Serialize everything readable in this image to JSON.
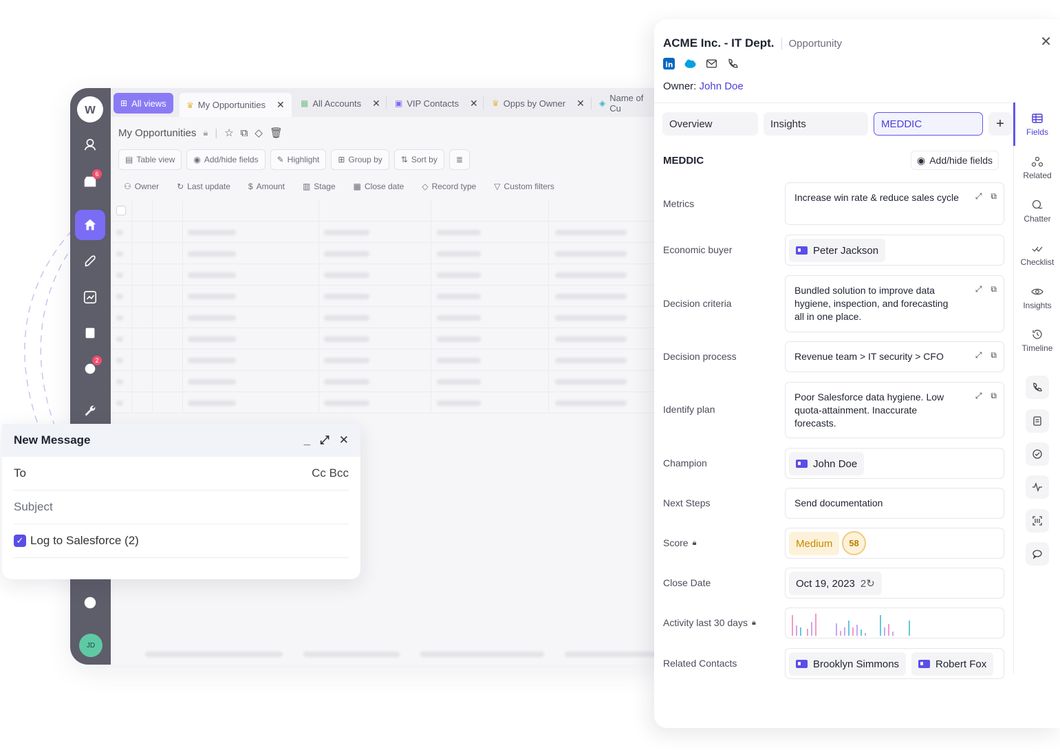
{
  "app": {
    "rail_badges": {
      "inbox": "6",
      "tasks": "2"
    },
    "avatar_initials": "JD",
    "tabs": [
      {
        "label": "All views",
        "icon": "grid-icon"
      },
      {
        "label": "My Opportunities",
        "icon": "crown-icon"
      },
      {
        "label": "All Accounts",
        "icon": "building-icon"
      },
      {
        "label": "VIP Contacts",
        "icon": "id-card-icon"
      },
      {
        "label": "Opps by Owner",
        "icon": "crown-icon"
      },
      {
        "label": "Name of Cu",
        "icon": "cube-icon"
      }
    ],
    "view_title": "My Opportunities",
    "toolbar": [
      "Table view",
      "Add/hide fields",
      "Highlight",
      "Group by",
      "Sort by"
    ],
    "filters": [
      "Owner",
      "Last update",
      "Amount",
      "Stage",
      "Close date",
      "Record type",
      "Custom filters"
    ]
  },
  "message": {
    "title": "New Message",
    "to_label": "To",
    "cc_bcc": "Cc Bcc",
    "subject_placeholder": "Subject",
    "log_label": "Log to Salesforce (2)"
  },
  "panel": {
    "title": "ACME Inc. - IT Dept.",
    "object_type": "Opportunity",
    "owner_label": "Owner:",
    "owner_name": "John Doe",
    "tabs": [
      "Overview",
      "Insights",
      "MEDDIC"
    ],
    "active_tab": "MEDDIC",
    "section_title": "MEDDIC",
    "add_hide_fields": "Add/hide fields",
    "fields": {
      "metrics": {
        "label": "Metrics",
        "value": "Increase win rate & reduce sales cycle"
      },
      "economic_buyer": {
        "label": "Economic buyer",
        "value": "Peter Jackson"
      },
      "decision_criteria": {
        "label": "Decision criteria",
        "value": "Bundled solution to improve data hygiene, inspection, and forecasting all in one place."
      },
      "decision_process": {
        "label": "Decision process",
        "value": "Revenue team > IT security > CFO"
      },
      "identify_plan": {
        "label": "Identify plan",
        "value": "Poor Salesforce data hygiene. Low quota-attainment. Inaccurate forecasts."
      },
      "champion": {
        "label": "Champion",
        "value": "John Doe"
      },
      "next_steps": {
        "label": "Next Steps",
        "value": "Send documentation"
      },
      "score": {
        "label": "Score",
        "level": "Medium",
        "value": "58"
      },
      "close_date": {
        "label": "Close Date",
        "value": "Oct 19, 2023",
        "pushes": "2"
      },
      "activity": {
        "label": "Activity last 30 days"
      },
      "related_contacts": {
        "label": "Related Contacts",
        "values": [
          "Brooklyn Simmons",
          "Robert Fox"
        ]
      }
    },
    "sidenav": [
      "Fields",
      "Related",
      "Chatter",
      "Checklist",
      "Insights",
      "Timeline"
    ]
  },
  "colors": {
    "accent": "#6157e8",
    "rail": "#5e5d6a",
    "medium_bg": "#fdf2d9",
    "badge": "#f0506e"
  }
}
